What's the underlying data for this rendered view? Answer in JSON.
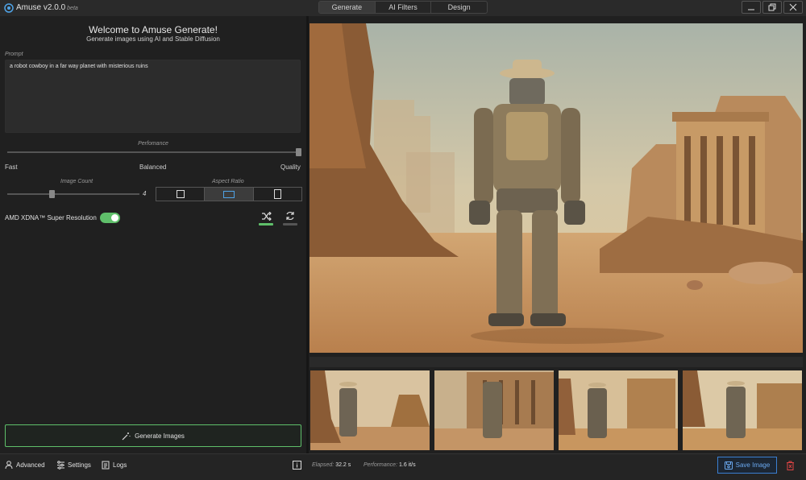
{
  "app": {
    "name": "Amuse v2.0.0",
    "tag": "beta"
  },
  "tabs": [
    {
      "label": "Generate",
      "active": true
    },
    {
      "label": "AI Filters",
      "active": false
    },
    {
      "label": "Design",
      "active": false
    }
  ],
  "window": {
    "minimize_icon": "minimize-icon",
    "restore_icon": "restore-icon",
    "close_icon": "close-icon"
  },
  "generate": {
    "title": "Welcome to Amuse Generate!",
    "subtitle": "Generate images using AI and Stable Diffusion",
    "prompt_label": "Prompt",
    "prompt_value": "a robot cowboy in a far way planet with misterious ruins",
    "performance_label": "Perfomance",
    "performance_ticks": [
      "Fast",
      "Balanced",
      "Quality"
    ],
    "performance_level": 1.0,
    "image_count_label": "Image Count",
    "image_count_value": "4",
    "image_count_level": 0.33,
    "aspect_ratio_label": "Aspect Ratio",
    "aspect_ratio_options": [
      "square",
      "landscape",
      "portrait"
    ],
    "aspect_ratio_selected": "landscape",
    "xdna_label": "AMD XDNA™ Super Resolution",
    "xdna_enabled": true,
    "generate_button": "Generate Images"
  },
  "bottom": {
    "advanced": "Advanced",
    "settings": "Settings",
    "logs": "Logs",
    "elapsed_label": "Elapsed:",
    "elapsed_value": "32.2 s",
    "performance_label": "Performance:",
    "performance_value": "1.6 it/s",
    "save_button": "Save Image"
  },
  "colors": {
    "accent_green": "#5fbf6a",
    "accent_blue": "#3b7fd1",
    "danger_red": "#e04545"
  }
}
